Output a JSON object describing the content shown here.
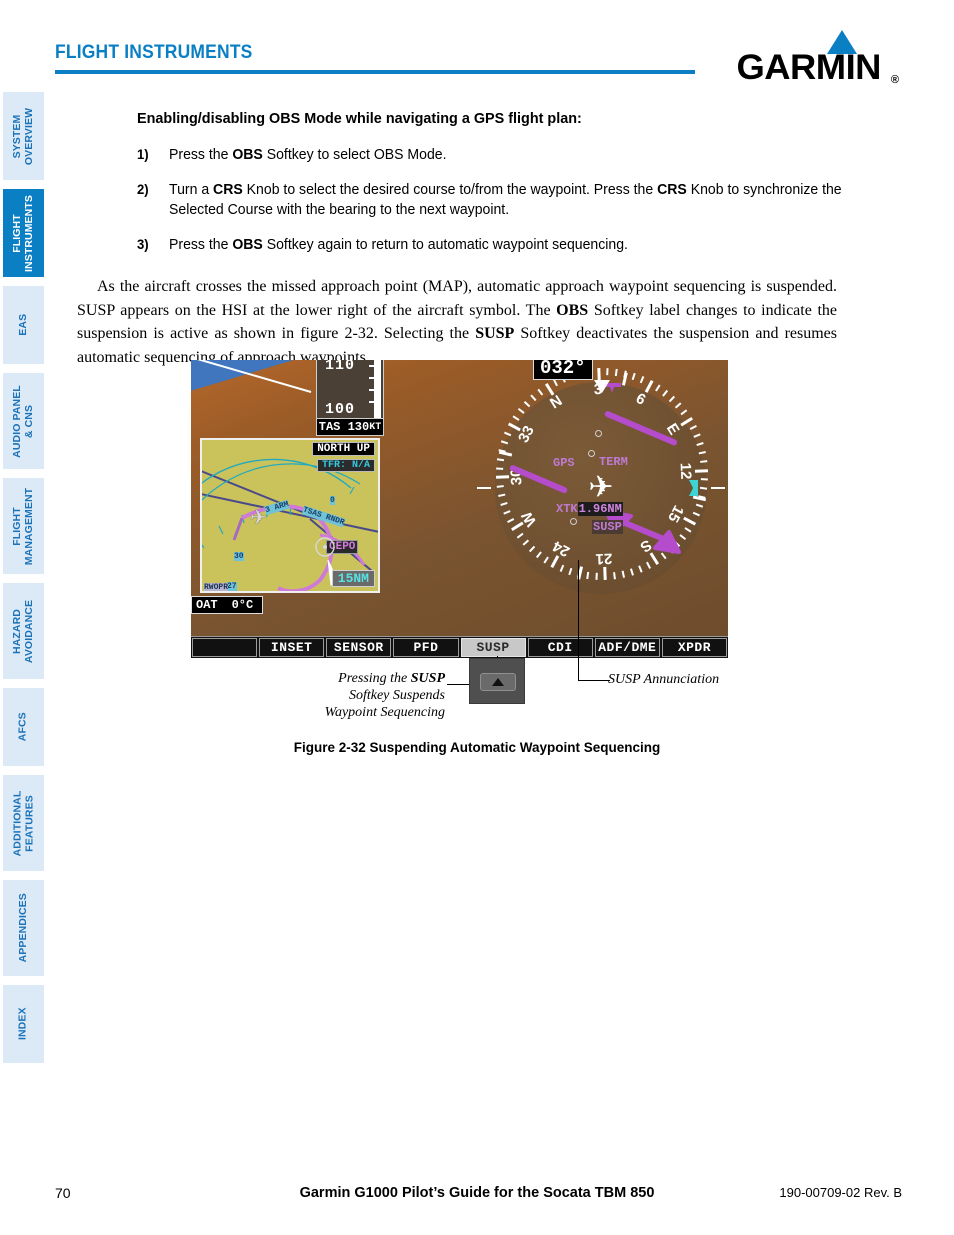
{
  "header": {
    "chapter_title": "FLIGHT INSTRUMENTS",
    "brand": "GARMIN",
    "brand_reg": "®",
    "accent_color": "#0b7fc4"
  },
  "sidebar": {
    "items": [
      {
        "label": "SYSTEM\nOVERVIEW",
        "active": false
      },
      {
        "label": "FLIGHT\nINSTRUMENTS",
        "active": true
      },
      {
        "label": "EAS",
        "active": false
      },
      {
        "label": "AUDIO PANEL\n& CNS",
        "active": false
      },
      {
        "label": "FLIGHT\nMANAGEMENT",
        "active": false
      },
      {
        "label": "HAZARD\nAVOIDANCE",
        "active": false
      },
      {
        "label": "AFCS",
        "active": false
      },
      {
        "label": "ADDITIONAL\nFEATURES",
        "active": false
      },
      {
        "label": "APPENDICES",
        "active": false
      },
      {
        "label": "INDEX",
        "active": false
      }
    ],
    "active_bg": "#0b7fc4",
    "inactive_bg": "#dce9f7",
    "inactive_fg": "#1a72b8"
  },
  "main": {
    "procedure_heading": "Enabling/disabling OBS Mode while navigating a GPS flight plan:",
    "steps": [
      {
        "num": "1)",
        "html": "Press the <b>OBS</b> Softkey to select OBS Mode."
      },
      {
        "num": "2)",
        "html": "Turn a <b>CRS</b> Knob to select the desired course to/from the waypoint.  Press the <b>CRS</b> Knob to synchronize the Selected Course with the bearing to the next waypoint."
      },
      {
        "num": "3)",
        "html": "Press the <b>OBS</b> Softkey again to return to automatic waypoint sequencing."
      }
    ],
    "paragraph_html": "As the aircraft crosses the missed approach point (MAP), automatic approach waypoint sequencing is suspended.  SUSP appears on the HSI at the lower right of the aircraft symbol.  The <b>OBS</b> Softkey label changes to indicate the suspension is active as shown in figure 2-32.  Selecting the <b>SUSP</b> Softkey deactivates the suspension and resumes automatic sequencing of approach waypoints."
  },
  "figure": {
    "caption": "Figure 2-32  Suspending Automatic Waypoint Sequencing",
    "callout_left_html": "Pressing the <b>SUSP</b><br>Softkey Suspends<br>Waypoint Sequencing",
    "callout_right": "SUSP Annunciation",
    "pfd": {
      "airspeed_upper": "110",
      "airspeed_lower": "100",
      "tas_label": "TAS",
      "tas_value": "130",
      "tas_unit": "KT",
      "oat_label": "OAT",
      "oat_value": "0°C",
      "inset_map": {
        "orientation": "NORTH UP",
        "tfr": "TFR: N/A",
        "range": "15NM",
        "waypoint_label": "CEPO",
        "airway_labels": [
          "3 ARM",
          "TSAS RNDR"
        ],
        "range_rings": [
          "30",
          "27"
        ],
        "vor_tag": "RWOPR"
      },
      "hsi": {
        "heading": "032°",
        "nav_source": "GPS",
        "mode_annunciation": "TERM",
        "xtk_label": "XTK",
        "xtk_value": "1.96NM",
        "susp_annunciation": "SUSP",
        "compass_labels": [
          "N",
          "3",
          "6",
          "E",
          "12",
          "15",
          "S",
          "21",
          "24",
          "W",
          "30",
          "33"
        ],
        "needle_color": "#b44ccb",
        "bug_color": "#3ed4d4"
      },
      "softkeys": [
        {
          "label": "",
          "selected": false
        },
        {
          "label": "INSET",
          "selected": false
        },
        {
          "label": "SENSOR",
          "selected": false
        },
        {
          "label": "PFD",
          "selected": false
        },
        {
          "label": "SUSP",
          "selected": true
        },
        {
          "label": "CDI",
          "selected": false
        },
        {
          "label": "ADF/DME",
          "selected": false
        },
        {
          "label": "XPDR",
          "selected": false
        }
      ]
    }
  },
  "footer": {
    "page_number": "70",
    "title": "Garmin G1000 Pilot’s Guide for the Socata TBM 850",
    "part_number": "190-00709-02  Rev. B"
  }
}
